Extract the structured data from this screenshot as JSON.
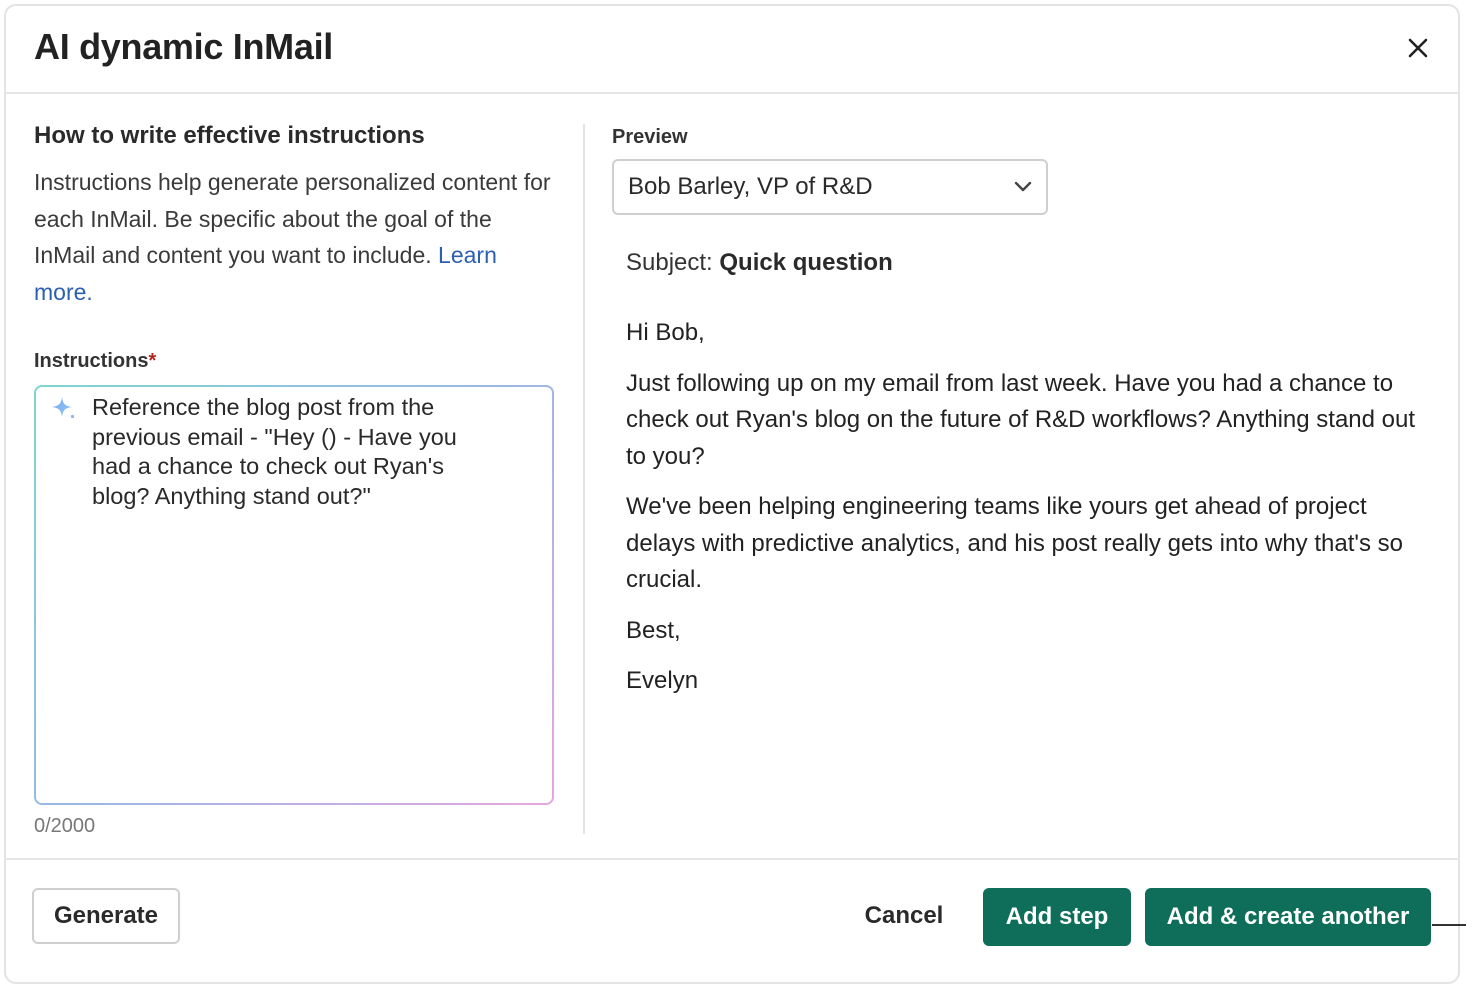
{
  "modal": {
    "title": "AI dynamic InMail",
    "close_icon": "close-icon"
  },
  "help": {
    "title": "How to write effective instructions",
    "text": "Instructions help generate personalized content for each InMail. Be specific about the goal of the InMail and content you want to include.",
    "link": "Learn more."
  },
  "instructions": {
    "label": "Instructions",
    "required_mark": "*",
    "icon": "sparkle-icon",
    "value": "Reference the blog post from the previous email - \"Hey () - Have you had a chance to check out Ryan's blog?  Anything stand out?\"",
    "counter": "0/2000"
  },
  "preview": {
    "label": "Preview",
    "recipient": "Bob Barley, VP of R&D",
    "subject_label": "Subject:",
    "subject": "Quick question",
    "body": [
      "Hi Bob,",
      "Just following up on my email from last week. Have you had a chance to check out Ryan's blog on the future of R&D workflows? Anything stand out to you?",
      "We've been helping engineering teams like yours get ahead of project delays with predictive analytics, and his post really gets into why that's so crucial.",
      "Best,",
      "Evelyn"
    ]
  },
  "footer": {
    "generate": "Generate",
    "cancel": "Cancel",
    "add_step": "Add step",
    "add_create_another": "Add & create another"
  },
  "colors": {
    "primary": "#0f6e5a",
    "link": "#2b5fb0",
    "required": "#b3261e"
  }
}
